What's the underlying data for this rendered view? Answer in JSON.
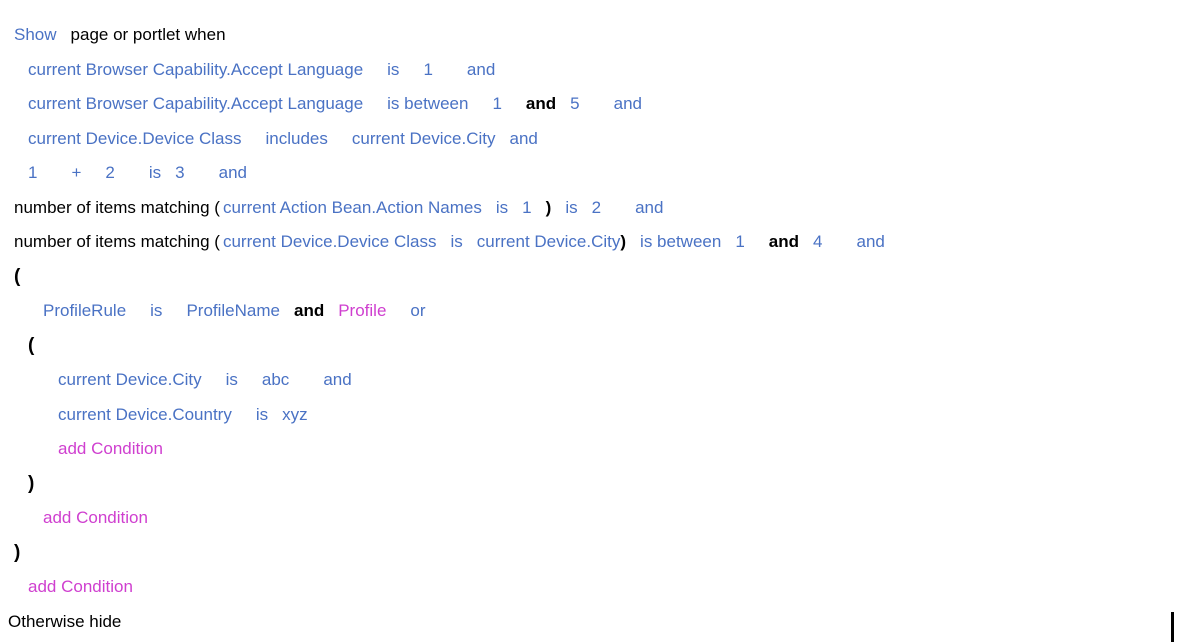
{
  "app": {
    "name": "rule-builder",
    "colors": {
      "field": "#4a72c4",
      "operator": "#4a72c4",
      "literal": "#4a72c4",
      "keyword": "#000000",
      "action_link": "#cf3fcf",
      "background": "#ffffff"
    }
  },
  "header": {
    "show_label": "Show",
    "target_label": "page or portlet when"
  },
  "footer": {
    "otherwise_label": "Otherwise hide"
  },
  "lines": {
    "l1": {
      "field": "current Browser Capability.Accept Language",
      "operator": "is",
      "value": "1",
      "conjunction": "and"
    },
    "l2": {
      "field": "current Browser Capability.Accept Language",
      "operator": "is between",
      "value_low": "1",
      "range_and": "and",
      "value_high": "5",
      "conjunction": "and"
    },
    "l3": {
      "field": "current Device.Device Class",
      "operator": "includes",
      "value": "current Device.City",
      "conjunction": "and"
    },
    "l4": {
      "operand_a": "1",
      "arith_op": "+",
      "operand_b": "2",
      "operator": "is",
      "value": "3",
      "conjunction": "and"
    },
    "l5": {
      "prefix": "number of items matching (",
      "field": "current Action Bean.Action Names",
      "inner_operator": "is",
      "inner_value": "1",
      "close_paren": ")",
      "operator": "is",
      "value": "2",
      "conjunction": "and"
    },
    "l6": {
      "prefix": "number of items matching (",
      "field": "current Device.Device Class",
      "inner_operator": "is",
      "inner_value": "current Device.City",
      "close_paren": ")",
      "operator": "is between",
      "value_low": "1",
      "range_and": "and",
      "value_high": "4",
      "conjunction": "and"
    },
    "l7": {
      "open_paren": "("
    },
    "l8": {
      "field": "ProfileRule",
      "operator": "is",
      "value": "ProfileName",
      "conjunction": "and",
      "profile_link": "Profile",
      "or_conjunction": "or"
    },
    "l9": {
      "open_paren": "("
    },
    "l10": {
      "field": "current Device.City",
      "operator": "is",
      "value": "abc",
      "conjunction": "and"
    },
    "l11": {
      "field": "current Device.Country",
      "operator": "is",
      "value": "xyz"
    },
    "l12": {
      "add_condition": "add Condition"
    },
    "l13": {
      "close_paren": ")"
    },
    "l14": {
      "add_condition": "add Condition"
    },
    "l15": {
      "close_paren": ")"
    },
    "l16": {
      "add_condition": "add Condition"
    }
  }
}
